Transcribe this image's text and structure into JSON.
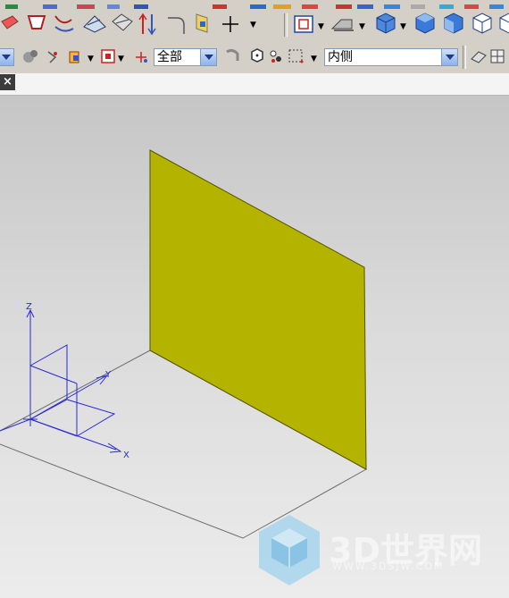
{
  "toolbar": {
    "selection_filter_value": "全部",
    "selection_scope_value": "内侧"
  },
  "tab": {
    "close_glyph": "×"
  },
  "viewport": {
    "plane_color": "#b3b300",
    "axis_color": "#2a2ad0",
    "axis_labels": {
      "z": "Z",
      "x": "X",
      "y": "Y"
    }
  },
  "watermark": {
    "brand": "3D世界网",
    "url": "WWW.3DSJW.COM"
  }
}
